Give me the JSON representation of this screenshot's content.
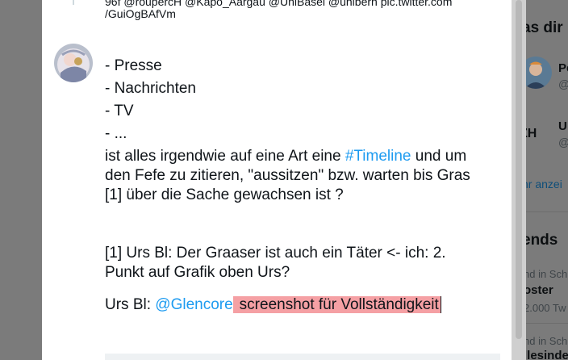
{
  "previous_tweet": {
    "cut_text": "96f @roupercH @Kapo_Aargau @UniBasel @unibern pic.twitter.com",
    "url_tail": "/GuiOgBAfVm"
  },
  "tweet": {
    "list_items": [
      "- Presse",
      "- Nachrichten",
      "- TV",
      "- ..."
    ],
    "line1_pre": "ist alles irgendwie auf eine Art eine ",
    "hashtag": "#Timeline",
    "line1_post": " und um",
    "line2": "den Fefe zu zitieren, \"aussitzen\" bzw. warten bis Gras",
    "line3": "[1] über die Sache gewachsen ist ?",
    "footnote_line1": "[1] Urs Bl: Der Graaser ist auch ein Täter <- ich: 2.",
    "footnote_line2": "Punkt auf Grafik oben Urs?",
    "mention_prefix": "Urs Bl: ",
    "mention": "@Glencore",
    "highlight": "screenshot für Vollständigkeit"
  },
  "sidebar": {
    "heading_follow": "as dir",
    "user1_name": "Pe",
    "user1_handle": "@",
    "user2_initials": "ZH",
    "user2_name": "U",
    "user2_handle": "@",
    "show_more": "hr anzei",
    "heading_trends": "ends",
    "trend1_context": "nd in Sch",
    "trend1_name": "oster",
    "trend1_count": "2.000 Tw",
    "trend2_context": "nd in Sch",
    "trend2_name": "llesinde"
  },
  "colors": {
    "link": "#1d9bf0",
    "highlight": "#f5a0a4",
    "overlay": "#7b7b7b"
  }
}
